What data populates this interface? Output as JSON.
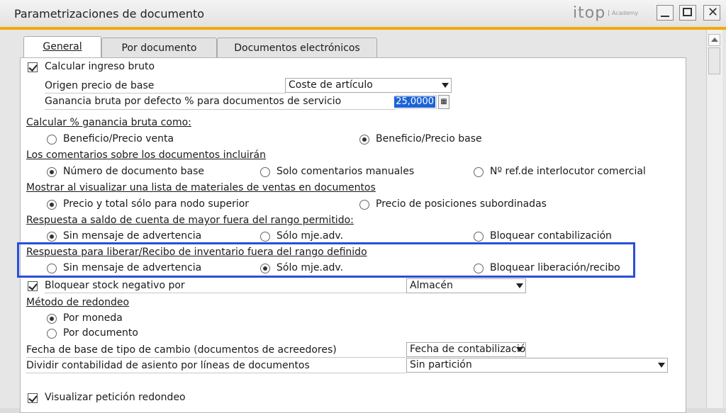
{
  "window": {
    "title": "Parametrizaciones de documento",
    "logo": "itop",
    "logo_sub": "Academy"
  },
  "tabs": [
    {
      "label": "General"
    },
    {
      "label": "Por documento"
    },
    {
      "label": "Documentos electrónicos"
    }
  ],
  "general": {
    "calcular_ingreso": {
      "label": "Calcular ingreso bruto",
      "checked": true
    },
    "origen_precio": {
      "label": "Origen precio de base",
      "value": "Coste de artículo"
    },
    "ganancia_bruta": {
      "label": "Ganancia bruta por defecto % para documentos de servicio",
      "value": "25,0000"
    },
    "calc_pct": {
      "header": "Calcular % ganancia bruta como:",
      "options": [
        "Beneficio/Precio venta",
        "Beneficio/Precio base"
      ],
      "selected": 1
    },
    "comentarios": {
      "header": "Los comentarios sobre los documentos incluirán",
      "options": [
        "Número de documento base",
        "Solo comentarios manuales",
        "Nº ref.de interlocutor comercial"
      ],
      "selected": 0
    },
    "lista_materiales": {
      "header": "Mostrar al visualizar una lista de materiales de ventas en documentos",
      "options": [
        "Precio y total sólo para nodo superior",
        "Precio de posiciones subordinadas"
      ],
      "selected": 0
    },
    "saldo_cuenta": {
      "header": "Respuesta a saldo de cuenta de mayor fuera del rango permitido:",
      "options": [
        "Sin mensaje de advertencia",
        "Sólo mje.adv.",
        "Bloquear contabilización"
      ],
      "selected": 0
    },
    "liberar_recibo": {
      "header": "Respuesta para liberar/Recibo de inventario fuera del rango definido",
      "options": [
        "Sin mensaje de advertencia",
        "Sólo mje.adv.",
        "Bloquear liberación/recibo"
      ],
      "selected": 1
    },
    "bloquear_stock": {
      "label": "Bloquear stock negativo por",
      "checked": true,
      "value": "Almacén"
    },
    "redondeo": {
      "header": "Método de redondeo",
      "options": [
        "Por moneda",
        "Por documento"
      ],
      "selected": 0
    },
    "fecha_cambio": {
      "label": "Fecha de base de tipo de cambio (documentos de acreedores)",
      "value": "Fecha de contabilizació"
    },
    "dividir": {
      "label": "Dividir contabilidad de asiento por líneas de documentos",
      "value": "Sin partición"
    },
    "visualizar_redondeo": {
      "label": "Visualizar petición redondeo",
      "checked": true
    }
  },
  "colors": {
    "accent": "#f2a900",
    "highlight": "#2a4fd8",
    "selection": "#1d63d6"
  }
}
